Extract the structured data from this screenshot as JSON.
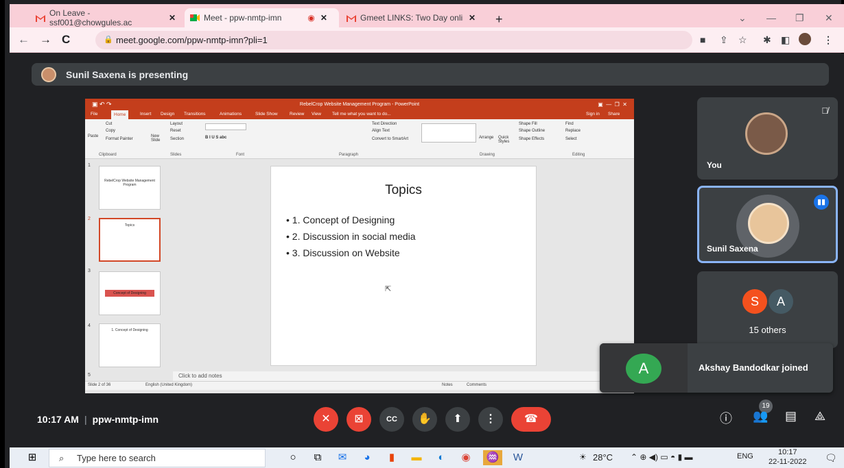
{
  "browser": {
    "tabs": [
      {
        "title": "On Leave - ssf001@chowgules.ac",
        "close": "✕"
      },
      {
        "title": "Meet - ppw-nmtp-imn",
        "close": "✕"
      },
      {
        "title": "Gmeet LINKS: Two Day online FD",
        "close": "✕"
      }
    ],
    "new_tab": "+",
    "url": "meet.google.com/ppw-nmtp-imn?pli=1"
  },
  "presenting_banner": "Sunil Saxena is presenting",
  "powerpoint": {
    "window_title": "RebelCrop Website Management Program - PowerPoint",
    "tabs": [
      "File",
      "Home",
      "Insert",
      "Design",
      "Transitions",
      "Animations",
      "Slide Show",
      "Review",
      "View",
      "Tell me what you want to do..."
    ],
    "sign_in": "Sign in",
    "share": "Share",
    "ribbon_groups": [
      "Clipboard",
      "Slides",
      "Font",
      "Paragraph",
      "Drawing",
      "Editing"
    ],
    "ribbon_items": {
      "cut": "Cut",
      "copy": "Copy",
      "paste": "Paste",
      "format_painter": "Format Painter",
      "new_slide": "New Slide",
      "layout": "Layout",
      "reset": "Reset",
      "section": "Section",
      "text_direction": "Text Direction",
      "align_text": "Align Text",
      "convert_smartart": "Convert to SmartArt",
      "arrange": "Arrange",
      "quick_styles": "Quick Styles",
      "shape_fill": "Shape Fill",
      "shape_outline": "Shape Outline",
      "shape_effects": "Shape Effects",
      "find": "Find",
      "replace": "Replace",
      "select": "Select"
    },
    "thumbnails": [
      {
        "num": "1",
        "text": "RebelCrop Website Management Program"
      },
      {
        "num": "2",
        "text": "Topics"
      },
      {
        "num": "3",
        "text": "Concept of Designing"
      },
      {
        "num": "4",
        "text": "1. Concept of Designing"
      },
      {
        "num": "5",
        "text": ""
      }
    ],
    "slide": {
      "title": "Topics",
      "bullets": [
        "1. Concept of Designing",
        "2. Discussion in social media",
        "3. Discussion on Website"
      ]
    },
    "notes_placeholder": "Click to add notes",
    "status": {
      "slide_count": "Slide 2 of 36",
      "language": "English (United Kingdom)",
      "notes": "Notes",
      "comments": "Comments"
    }
  },
  "participants": {
    "you_label": "You",
    "presenter_label": "Sunil Saxena",
    "others_avatars": [
      "S",
      "A"
    ],
    "others_label": "15 others"
  },
  "notification": {
    "avatar": "A",
    "message": "Akshay Bandodkar joined"
  },
  "meeting": {
    "time": "10:17 AM",
    "code": "ppw-nmtp-imn",
    "participant_count": "19"
  },
  "taskbar": {
    "search_placeholder": "Type here to search",
    "temperature": "28°C",
    "language": "ENG",
    "clock_time": "10:17",
    "clock_date": "22-11-2022"
  },
  "colors": {
    "red": "#ea4335",
    "meet_bg": "#202124",
    "ppt_red": "#c43e1c",
    "active_border": "#8ab4f8"
  }
}
